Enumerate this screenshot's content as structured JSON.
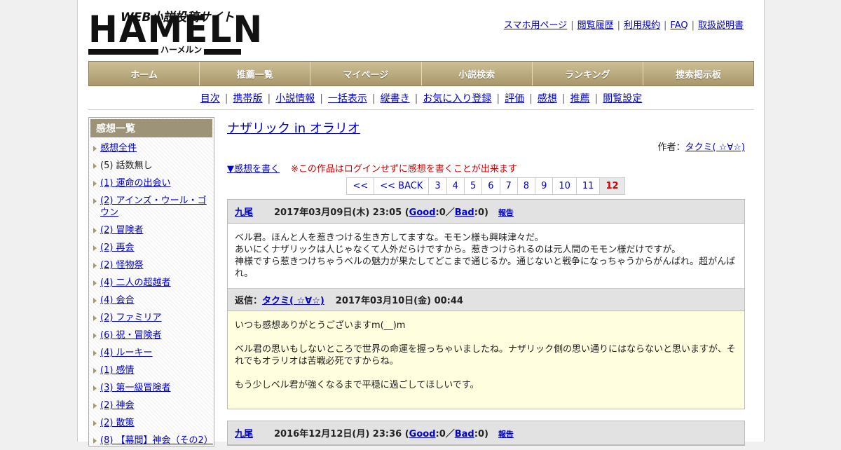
{
  "logo": {
    "subtitle": "WEB小説投稿サイト",
    "main": "HAMELN",
    "kana": "ハーメルン"
  },
  "toplinks": [
    "スマホ用ページ",
    "閲覧履歴",
    "利用規約",
    "FAQ",
    "取扱説明書"
  ],
  "mainnav": [
    "ホーム",
    "推薦一覧",
    "マイページ",
    "小説検索",
    "ランキング",
    "捜索掲示板"
  ],
  "subnav": [
    "目次",
    "携帯版",
    "小説情報",
    "一括表示",
    "縦書き",
    "お気に入り登録",
    "評価",
    "感想",
    "推薦",
    "閲覧設定"
  ],
  "sidebar": {
    "title": "感想一覧",
    "items": [
      {
        "label": "感想全件",
        "link": true
      },
      {
        "label": "(5) 話数無し",
        "link": false
      },
      {
        "label": "(1) 運命の出会い",
        "link": true
      },
      {
        "label": "(2) アインズ・ウール・ゴウン",
        "link": true
      },
      {
        "label": "(2) 冒険者",
        "link": true
      },
      {
        "label": "(2) 再会",
        "link": true
      },
      {
        "label": "(2) 怪物祭",
        "link": true
      },
      {
        "label": "(4) 二人の超越者",
        "link": true
      },
      {
        "label": "(4) 会合",
        "link": true
      },
      {
        "label": "(2) ファミリア",
        "link": true
      },
      {
        "label": "(6) 祝・冒険者",
        "link": true
      },
      {
        "label": "(4) ルーキー",
        "link": true
      },
      {
        "label": "(1) 感情",
        "link": true
      },
      {
        "label": "(3) 第一級冒険者",
        "link": true
      },
      {
        "label": "(2) 神会",
        "link": true
      },
      {
        "label": "(2) 散策",
        "link": true
      },
      {
        "label": "(8) 【幕間】神会（その2）",
        "link": true
      }
    ]
  },
  "work": {
    "title": "ナザリック in オラリオ",
    "author_label": "作者：",
    "author": "タクミ( ☆∀☆)",
    "write_link": "▼感想を書く",
    "notice": "※この作品はログインせずに感想を書くことが出来ます"
  },
  "pager": {
    "items": [
      "<<",
      "<< BACK",
      "3",
      "4",
      "5",
      "6",
      "7",
      "8",
      "9",
      "10",
      "11",
      "12"
    ],
    "current": "12"
  },
  "reviews": [
    {
      "user": "九尾",
      "date": "2017年03月09日(木) 23:05",
      "open": "(",
      "good_label": "Good",
      "good_count": ":0／",
      "bad_label": "Bad",
      "bad_count": ":0)",
      "report": "報告",
      "body": [
        "ベル君。ほんと人を惹きつける生き方してますな。モモン様も興味津々だ。",
        "あいにくナザリックは人じゃなくて人外だらけですから。惹きつけられるのは元人間のモモン様だけですが。",
        "神様ですら惹きつけちゃうベルの魅力が果たしてどこまで通じるか。通じないと戦争になっちゃうからがんばれ。超がんばれ。"
      ],
      "reply": {
        "label": "返信：",
        "user": "タクミ( ☆∀☆)",
        "date": "2017年03月10日(金) 00:44",
        "paragraphs": [
          "いつも感想ありがとうございますm(__)m",
          "ベル君の思いもしないところで世界の命運を握っちゃいましたね。ナザリック側の思い通りにはならないと思いますが、それでもオラリオは苦戦必死ですからね。",
          "もう少しベル君が強くなるまで平穏に過ごしてほしいです。"
        ]
      }
    },
    {
      "user": "九尾",
      "date": "2016年12月12日(月) 23:36",
      "open": "(",
      "good_label": "Good",
      "good_count": ":0／",
      "bad_label": "Bad",
      "bad_count": ":0)",
      "report": "報告"
    }
  ]
}
